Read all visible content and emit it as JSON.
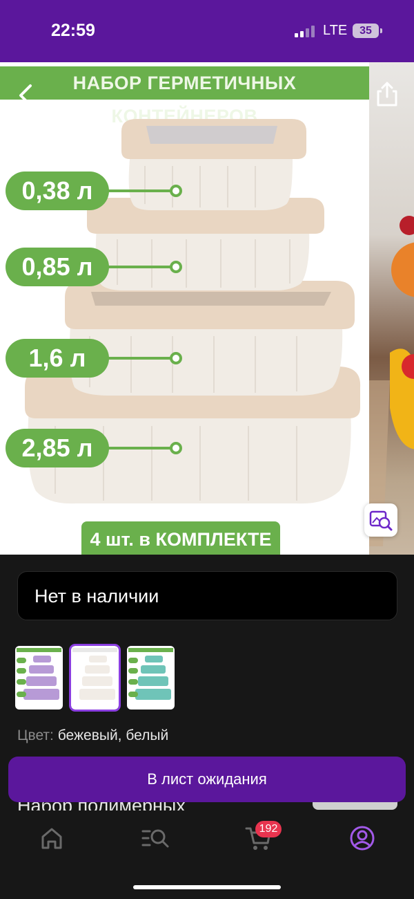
{
  "status_bar": {
    "time": "22:59",
    "network": "LTE",
    "battery": "35",
    "background": "#5b179c"
  },
  "gallery": {
    "headline": "НАБОР ГЕРМЕТИЧНЫХ КОНТЕЙНЕРОВ",
    "back_icon": "chevron-left-icon",
    "share_icon": "share-icon",
    "visual_search_icon": "image-search-icon",
    "volumes": [
      "0,38 л",
      "0,85 л",
      "1,6 л",
      "2,85 л"
    ],
    "kit_label": "4 шт. в КОМПЛЕКТЕ",
    "accent": "#6ab04c"
  },
  "stock": {
    "label": "Нет в наличии"
  },
  "variants": {
    "thumbnails": [
      {
        "color": "#b79ad6",
        "selected": false
      },
      {
        "color": "#f1ece6",
        "selected": true
      },
      {
        "color": "#6fc4b8",
        "selected": false
      }
    ]
  },
  "color_info": {
    "label": "Цвет:",
    "value": "бежевый, белый"
  },
  "peek_title": "Набор полимерных",
  "wait_button": "В лист ожидания",
  "tabbar": {
    "tabs": [
      "home-icon",
      "catalog-search-icon",
      "cart-icon",
      "profile-icon"
    ],
    "cart_count": "192",
    "active_color": "#a259e8"
  }
}
